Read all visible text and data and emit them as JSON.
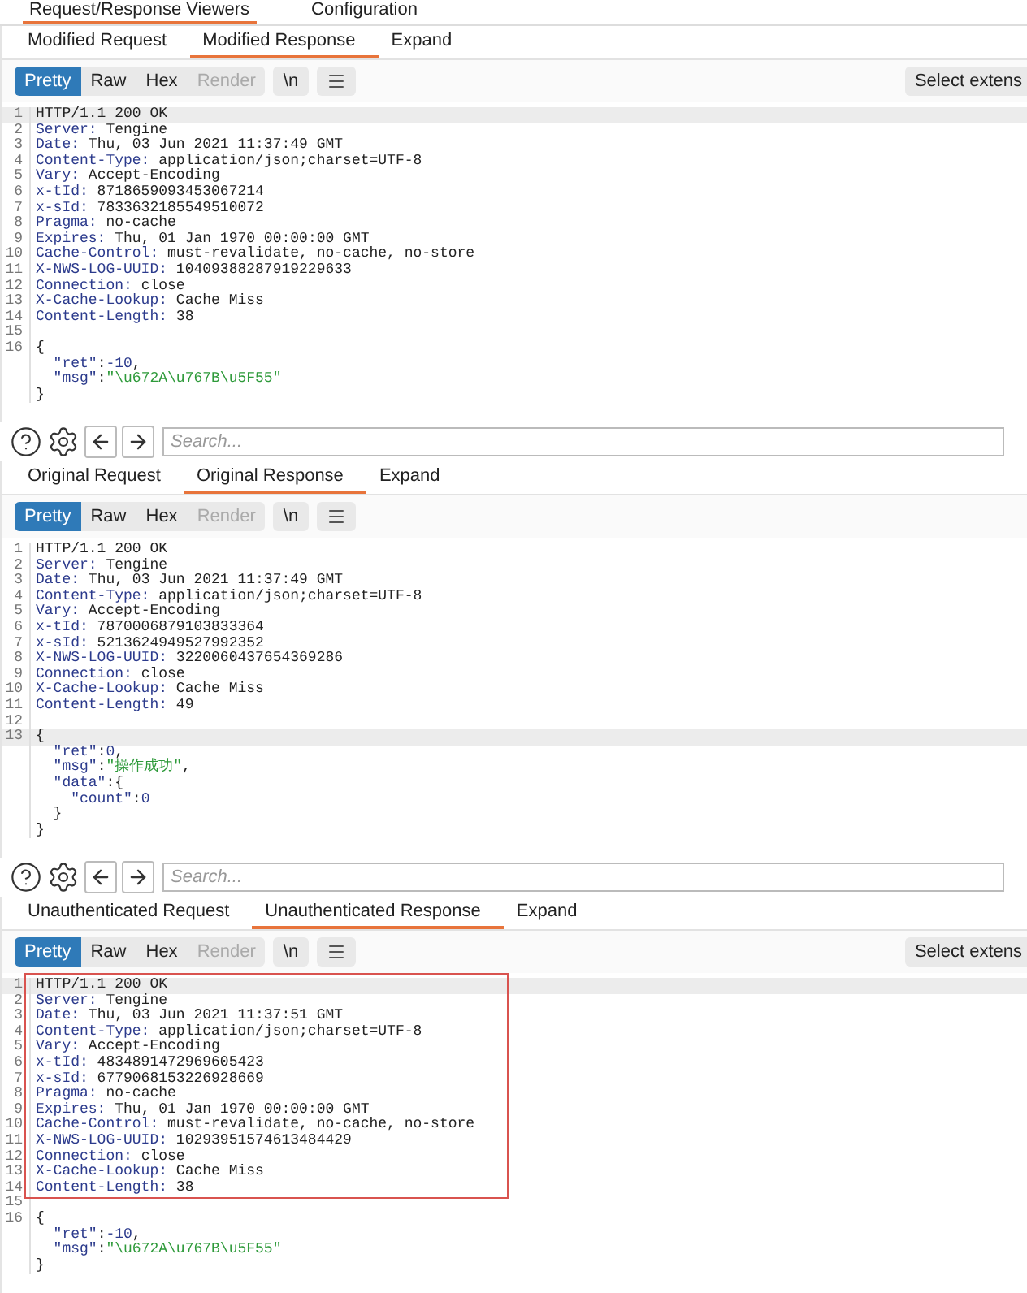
{
  "top_tabs": [
    {
      "label": "Request/Response Viewers",
      "selected": true
    },
    {
      "label": "Configuration",
      "selected": false
    }
  ],
  "panels": [
    {
      "tabs": [
        {
          "label": "Modified Request",
          "selected": false
        },
        {
          "label": "Modified Response",
          "selected": true
        },
        {
          "label": "Expand",
          "selected": false
        }
      ],
      "view_buttons": [
        {
          "label": "Pretty",
          "selected": true,
          "disabled": false
        },
        {
          "label": "Raw",
          "selected": false,
          "disabled": false
        },
        {
          "label": "Hex",
          "selected": false,
          "disabled": false
        },
        {
          "label": "Render",
          "selected": false,
          "disabled": true
        }
      ],
      "newline_button": "\\n",
      "extension_button": "Select extens",
      "highlight_box": false,
      "headers": [
        {
          "number": "1",
          "current": true,
          "tokens": [
            {
              "kind": "status",
              "text": "HTTP/1.1 200 OK"
            }
          ]
        },
        {
          "number": "2",
          "current": false,
          "tokens": [
            {
              "kind": "name",
              "text": "Server:"
            },
            {
              "kind": "value",
              "text": " Tengine"
            }
          ]
        },
        {
          "number": "3",
          "current": false,
          "tokens": [
            {
              "kind": "name",
              "text": "Date:"
            },
            {
              "kind": "value",
              "text": " Thu, 03 Jun 2021 11:37:49 GMT"
            }
          ]
        },
        {
          "number": "4",
          "current": false,
          "tokens": [
            {
              "kind": "name",
              "text": "Content-Type:"
            },
            {
              "kind": "value",
              "text": " application/json;charset=UTF-8"
            }
          ]
        },
        {
          "number": "5",
          "current": false,
          "tokens": [
            {
              "kind": "name",
              "text": "Vary:"
            },
            {
              "kind": "value",
              "text": " Accept-Encoding"
            }
          ]
        },
        {
          "number": "6",
          "current": false,
          "tokens": [
            {
              "kind": "name",
              "text": "x-tId:"
            },
            {
              "kind": "value",
              "text": " 8718659093453067214"
            }
          ]
        },
        {
          "number": "7",
          "current": false,
          "tokens": [
            {
              "kind": "name",
              "text": "x-sId:"
            },
            {
              "kind": "value",
              "text": " 7833632185549510072"
            }
          ]
        },
        {
          "number": "8",
          "current": false,
          "tokens": [
            {
              "kind": "name",
              "text": "Pragma:"
            },
            {
              "kind": "value",
              "text": " no-cache"
            }
          ]
        },
        {
          "number": "9",
          "current": false,
          "tokens": [
            {
              "kind": "name",
              "text": "Expires:"
            },
            {
              "kind": "value",
              "text": " Thu, 01 Jan 1970 00:00:00 GMT"
            }
          ]
        },
        {
          "number": "10",
          "current": false,
          "tokens": [
            {
              "kind": "name",
              "text": "Cache-Control:"
            },
            {
              "kind": "value",
              "text": " must-revalidate, no-cache, no-store"
            }
          ]
        },
        {
          "number": "11",
          "current": false,
          "tokens": [
            {
              "kind": "name",
              "text": "X-NWS-LOG-UUID:"
            },
            {
              "kind": "value",
              "text": " 10409388287919229633"
            }
          ]
        },
        {
          "number": "12",
          "current": false,
          "tokens": [
            {
              "kind": "name",
              "text": "Connection:"
            },
            {
              "kind": "value",
              "text": " close"
            }
          ]
        },
        {
          "number": "13",
          "current": false,
          "tokens": [
            {
              "kind": "name",
              "text": "X-Cache-Lookup:"
            },
            {
              "kind": "value",
              "text": " Cache Miss"
            }
          ]
        },
        {
          "number": "14",
          "current": false,
          "tokens": [
            {
              "kind": "name",
              "text": "Content-Length:"
            },
            {
              "kind": "value",
              "text": " 38"
            }
          ]
        }
      ],
      "body": [
        {
          "number": "15",
          "current": false
        },
        {
          "number": "16",
          "current": false,
          "tokens": [
            {
              "kind": "punct",
              "text": "{"
            }
          ]
        },
        {
          "current": false,
          "tokens": [
            {
              "kind": "key",
              "text": "  \"ret\""
            },
            {
              "kind": "punct",
              "text": ":"
            },
            {
              "kind": "number",
              "text": "-10"
            },
            {
              "kind": "punct",
              "text": ","
            }
          ]
        },
        {
          "current": false,
          "tokens": [
            {
              "kind": "key",
              "text": "  \"msg\""
            },
            {
              "kind": "punct",
              "text": ":"
            },
            {
              "kind": "string",
              "text": "\"\\u672A\\u767B\\u5F55\""
            }
          ]
        },
        {
          "current": false,
          "tokens": [
            {
              "kind": "punct",
              "text": "}"
            }
          ]
        }
      ]
    },
    {
      "tabs": [
        {
          "label": "Original Request",
          "selected": false
        },
        {
          "label": "Original Response",
          "selected": true
        },
        {
          "label": "Expand",
          "selected": false
        }
      ],
      "view_buttons": [
        {
          "label": "Pretty",
          "selected": true,
          "disabled": false
        },
        {
          "label": "Raw",
          "selected": false,
          "disabled": false
        },
        {
          "label": "Hex",
          "selected": false,
          "disabled": false
        },
        {
          "label": "Render",
          "selected": false,
          "disabled": true
        }
      ],
      "newline_button": "\\n",
      "highlight_box": false,
      "headers": [
        {
          "number": "1",
          "current": false,
          "tokens": [
            {
              "kind": "status",
              "text": "HTTP/1.1 200 OK"
            }
          ]
        },
        {
          "number": "2",
          "current": false,
          "tokens": [
            {
              "kind": "name",
              "text": "Server:"
            },
            {
              "kind": "value",
              "text": " Tengine"
            }
          ]
        },
        {
          "number": "3",
          "current": false,
          "tokens": [
            {
              "kind": "name",
              "text": "Date:"
            },
            {
              "kind": "value",
              "text": " Thu, 03 Jun 2021 11:37:49 GMT"
            }
          ]
        },
        {
          "number": "4",
          "current": false,
          "tokens": [
            {
              "kind": "name",
              "text": "Content-Type:"
            },
            {
              "kind": "value",
              "text": " application/json;charset=UTF-8"
            }
          ]
        },
        {
          "number": "5",
          "current": false,
          "tokens": [
            {
              "kind": "name",
              "text": "Vary:"
            },
            {
              "kind": "value",
              "text": " Accept-Encoding"
            }
          ]
        },
        {
          "number": "6",
          "current": false,
          "tokens": [
            {
              "kind": "name",
              "text": "x-tId:"
            },
            {
              "kind": "value",
              "text": " 7870006879103833364"
            }
          ]
        },
        {
          "number": "7",
          "current": false,
          "tokens": [
            {
              "kind": "name",
              "text": "x-sId:"
            },
            {
              "kind": "value",
              "text": " 5213624949527992352"
            }
          ]
        },
        {
          "number": "8",
          "current": false,
          "tokens": [
            {
              "kind": "name",
              "text": "X-NWS-LOG-UUID:"
            },
            {
              "kind": "value",
              "text": " 3220060437654369286"
            }
          ]
        },
        {
          "number": "9",
          "current": false,
          "tokens": [
            {
              "kind": "name",
              "text": "Connection:"
            },
            {
              "kind": "value",
              "text": " close"
            }
          ]
        },
        {
          "number": "10",
          "current": false,
          "tokens": [
            {
              "kind": "name",
              "text": "X-Cache-Lookup:"
            },
            {
              "kind": "value",
              "text": " Cache Miss"
            }
          ]
        },
        {
          "number": "11",
          "current": false,
          "tokens": [
            {
              "kind": "name",
              "text": "Content-Length:"
            },
            {
              "kind": "value",
              "text": " 49"
            }
          ]
        }
      ],
      "body": [
        {
          "number": "12",
          "current": false
        },
        {
          "number": "13",
          "current": true,
          "tokens": [
            {
              "kind": "punct",
              "text": "{"
            }
          ]
        },
        {
          "current": false,
          "tokens": [
            {
              "kind": "key",
              "text": "  \"ret\""
            },
            {
              "kind": "punct",
              "text": ":"
            },
            {
              "kind": "number",
              "text": "0"
            },
            {
              "kind": "punct",
              "text": ","
            }
          ]
        },
        {
          "current": false,
          "tokens": [
            {
              "kind": "key",
              "text": "  \"msg\""
            },
            {
              "kind": "punct",
              "text": ":"
            },
            {
              "kind": "string",
              "text": "\"操作成功\""
            },
            {
              "kind": "punct",
              "text": ","
            }
          ]
        },
        {
          "current": false,
          "tokens": [
            {
              "kind": "key",
              "text": "  \"data\""
            },
            {
              "kind": "punct",
              "text": ":{"
            }
          ]
        },
        {
          "current": false,
          "tokens": [
            {
              "kind": "key",
              "text": "    \"count\""
            },
            {
              "kind": "punct",
              "text": ":"
            },
            {
              "kind": "number",
              "text": "0"
            }
          ]
        },
        {
          "current": false,
          "tokens": [
            {
              "kind": "punct",
              "text": "  }"
            }
          ]
        },
        {
          "current": false,
          "tokens": [
            {
              "kind": "punct",
              "text": "}"
            }
          ]
        }
      ]
    },
    {
      "tabs": [
        {
          "label": "Unauthenticated Request",
          "selected": false
        },
        {
          "label": "Unauthenticated Response",
          "selected": true
        },
        {
          "label": "Expand",
          "selected": false
        }
      ],
      "view_buttons": [
        {
          "label": "Pretty",
          "selected": true,
          "disabled": false
        },
        {
          "label": "Raw",
          "selected": false,
          "disabled": false
        },
        {
          "label": "Hex",
          "selected": false,
          "disabled": false
        },
        {
          "label": "Render",
          "selected": false,
          "disabled": true
        }
      ],
      "newline_button": "\\n",
      "extension_button": "Select extens",
      "highlight_box": true,
      "headers": [
        {
          "number": "1",
          "current": true,
          "tokens": [
            {
              "kind": "status",
              "text": "HTTP/1.1 200 OK"
            }
          ]
        },
        {
          "number": "2",
          "current": false,
          "tokens": [
            {
              "kind": "name",
              "text": "Server:"
            },
            {
              "kind": "value",
              "text": " Tengine"
            }
          ]
        },
        {
          "number": "3",
          "current": false,
          "tokens": [
            {
              "kind": "name",
              "text": "Date:"
            },
            {
              "kind": "value",
              "text": " Thu, 03 Jun 2021 11:37:51 GMT"
            }
          ]
        },
        {
          "number": "4",
          "current": false,
          "tokens": [
            {
              "kind": "name",
              "text": "Content-Type:"
            },
            {
              "kind": "value",
              "text": " application/json;charset=UTF-8"
            }
          ]
        },
        {
          "number": "5",
          "current": false,
          "tokens": [
            {
              "kind": "name",
              "text": "Vary:"
            },
            {
              "kind": "value",
              "text": " Accept-Encoding"
            }
          ]
        },
        {
          "number": "6",
          "current": false,
          "tokens": [
            {
              "kind": "name",
              "text": "x-tId:"
            },
            {
              "kind": "value",
              "text": " 4834891472969605423"
            }
          ]
        },
        {
          "number": "7",
          "current": false,
          "tokens": [
            {
              "kind": "name",
              "text": "x-sId:"
            },
            {
              "kind": "value",
              "text": " 6779068153226928669"
            }
          ]
        },
        {
          "number": "8",
          "current": false,
          "tokens": [
            {
              "kind": "name",
              "text": "Pragma:"
            },
            {
              "kind": "value",
              "text": " no-cache"
            }
          ]
        },
        {
          "number": "9",
          "current": false,
          "tokens": [
            {
              "kind": "name",
              "text": "Expires:"
            },
            {
              "kind": "value",
              "text": " Thu, 01 Jan 1970 00:00:00 GMT"
            }
          ]
        },
        {
          "number": "10",
          "current": false,
          "tokens": [
            {
              "kind": "name",
              "text": "Cache-Control:"
            },
            {
              "kind": "value",
              "text": " must-revalidate, no-cache, no-store"
            }
          ]
        },
        {
          "number": "11",
          "current": false,
          "tokens": [
            {
              "kind": "name",
              "text": "X-NWS-LOG-UUID:"
            },
            {
              "kind": "value",
              "text": " 10293951574613484429"
            }
          ]
        },
        {
          "number": "12",
          "current": false,
          "tokens": [
            {
              "kind": "name",
              "text": "Connection:"
            },
            {
              "kind": "value",
              "text": " close"
            }
          ]
        },
        {
          "number": "13",
          "current": false,
          "tokens": [
            {
              "kind": "name",
              "text": "X-Cache-Lookup:"
            },
            {
              "kind": "value",
              "text": " Cache Miss"
            }
          ]
        },
        {
          "number": "14",
          "current": false,
          "tokens": [
            {
              "kind": "name",
              "text": "Content-Length:"
            },
            {
              "kind": "value",
              "text": " 38"
            }
          ]
        }
      ],
      "body": [
        {
          "number": "15",
          "current": false
        },
        {
          "number": "16",
          "current": false,
          "tokens": [
            {
              "kind": "punct",
              "text": "{"
            }
          ]
        },
        {
          "current": false,
          "tokens": [
            {
              "kind": "key",
              "text": "  \"ret\""
            },
            {
              "kind": "punct",
              "text": ":"
            },
            {
              "kind": "number",
              "text": "-10"
            },
            {
              "kind": "punct",
              "text": ","
            }
          ]
        },
        {
          "current": false,
          "tokens": [
            {
              "kind": "key",
              "text": "  \"msg\""
            },
            {
              "kind": "punct",
              "text": ":"
            },
            {
              "kind": "string",
              "text": "\"\\u672A\\u767B\\u5F55\""
            }
          ]
        },
        {
          "current": false,
          "tokens": [
            {
              "kind": "punct",
              "text": "}"
            }
          ]
        }
      ]
    }
  ],
  "search_bars": [
    {
      "placeholder": "Search..."
    },
    {
      "placeholder": "Search..."
    }
  ]
}
